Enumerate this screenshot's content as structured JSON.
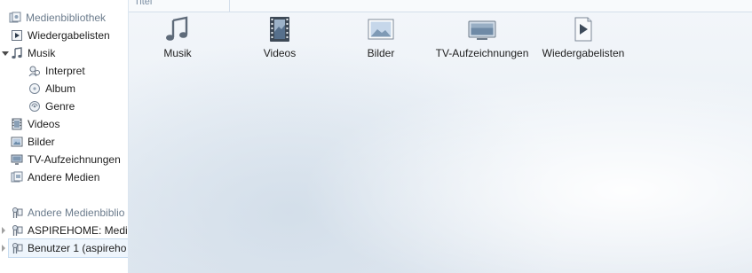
{
  "sidebar": {
    "items": [
      {
        "label": "Medienbibliothek",
        "icon": "library-icon"
      },
      {
        "label": "Wiedergabelisten",
        "icon": "playlist-icon"
      },
      {
        "label": "Musik",
        "icon": "music-note-icon"
      },
      {
        "label": "Interpret",
        "icon": "artist-icon"
      },
      {
        "label": "Album",
        "icon": "album-icon"
      },
      {
        "label": "Genre",
        "icon": "genre-icon"
      },
      {
        "label": "Videos",
        "icon": "video-icon"
      },
      {
        "label": "Bilder",
        "icon": "picture-icon"
      },
      {
        "label": "TV-Aufzeichnungen",
        "icon": "tv-icon"
      },
      {
        "label": "Andere Medien",
        "icon": "other-media-icon"
      },
      {
        "label": "Andere Medienbiblio",
        "icon": "shared-library-icon"
      },
      {
        "label": "ASPIREHOME: Media",
        "icon": "shared-library-icon"
      },
      {
        "label": "Benutzer 1 (aspireho",
        "icon": "shared-library-icon"
      }
    ]
  },
  "main": {
    "column_title": "Titel",
    "tiles": [
      {
        "label": "Musik",
        "icon": "music-note-icon"
      },
      {
        "label": "Videos",
        "icon": "film-icon"
      },
      {
        "label": "Bilder",
        "icon": "picture-icon"
      },
      {
        "label": "TV-Aufzeichnungen",
        "icon": "tv-icon"
      },
      {
        "label": "Wiedergabelisten",
        "icon": "playlist-icon"
      }
    ]
  }
}
